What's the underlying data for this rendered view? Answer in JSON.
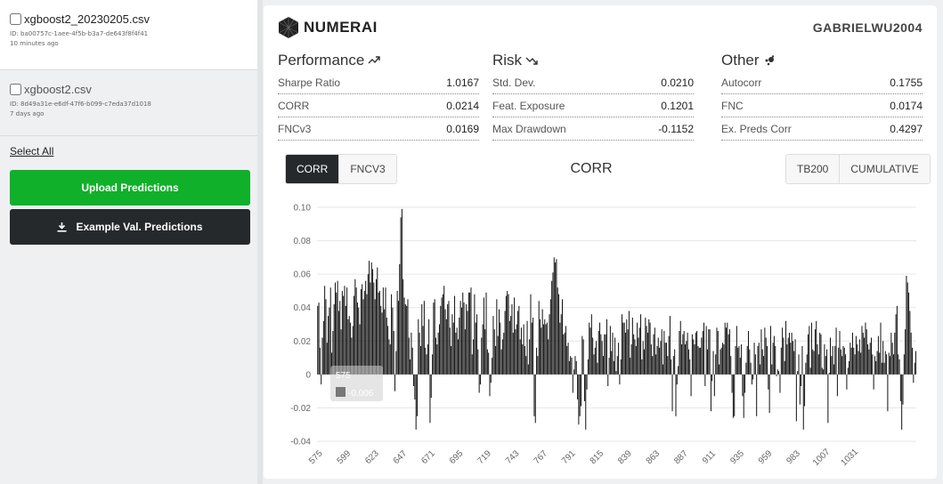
{
  "sidebar": {
    "files": [
      {
        "name": "xgboost2_20230205.csv",
        "id": "ID: ba00757c-1aee-4f5b-b3a7-de643f8f4f41",
        "age": "10 minutes ago"
      },
      {
        "name": "xgboost2.csv",
        "id": "ID: 8d49a31e-e6df-47f6-b099-c7eda37d1018",
        "age": "7 days ago"
      }
    ],
    "select_all": "Select All",
    "upload_label": "Upload Predictions",
    "example_label": "Example Val. Predictions"
  },
  "header": {
    "logo": "NUMERAI",
    "username": "GABRIELWU2004"
  },
  "metrics": {
    "performance": {
      "title": "Performance",
      "rows": [
        {
          "label": "Sharpe Ratio",
          "value": "1.0167"
        },
        {
          "label": "CORR",
          "value": "0.0214"
        },
        {
          "label": "FNCv3",
          "value": "0.0169"
        }
      ]
    },
    "risk": {
      "title": "Risk",
      "rows": [
        {
          "label": "Std. Dev.",
          "value": "0.0210"
        },
        {
          "label": "Feat. Exposure",
          "value": "0.1201"
        },
        {
          "label": "Max Drawdown",
          "value": "-0.1152"
        }
      ]
    },
    "other": {
      "title": "Other",
      "rows": [
        {
          "label": "Autocorr",
          "value": "0.1755"
        },
        {
          "label": "FNC",
          "value": "0.0174"
        },
        {
          "label": "Ex. Preds Corr",
          "value": "0.4297"
        }
      ]
    }
  },
  "chart_controls": {
    "tab_corr": "CORR",
    "tab_fncv3": "FNCV3",
    "title": "CORR",
    "tab_tb200": "TB200",
    "tab_cumulative": "CUMULATIVE"
  },
  "tooltip": {
    "era": "575",
    "value": "-0.006"
  },
  "colors": {
    "green": "#10b02a",
    "dark": "#26292c",
    "bar": "#111111"
  },
  "chart_data": {
    "type": "bar",
    "title": "CORR",
    "xlabel": "",
    "ylabel": "",
    "ylim": [
      -0.04,
      0.1
    ],
    "yticks": [
      0.1,
      0.08,
      0.06,
      0.04,
      0.02,
      0,
      -0.02,
      -0.04
    ],
    "ytick_labels": [
      "0.10",
      "0.08",
      "0.06",
      "0.04",
      "0.02",
      "0",
      "-0.02",
      "-0.04"
    ],
    "xticks": [
      575,
      599,
      623,
      647,
      671,
      695,
      719,
      743,
      767,
      791,
      815,
      839,
      863,
      887,
      911,
      935,
      959,
      983,
      1007,
      1031
    ],
    "x_start": 575,
    "values": [
      0.041,
      0.043,
      0.016,
      -0.006,
      0.022,
      0.032,
      0.053,
      0.045,
      0.019,
      0.035,
      0.04,
      0.052,
      0.013,
      0.026,
      0.042,
      0.055,
      0.049,
      0.056,
      0.038,
      0.044,
      0.027,
      0.05,
      0.047,
      0.053,
      0.041,
      0.052,
      0.033,
      0.035,
      0.031,
      0.022,
      0.029,
      0.047,
      0.057,
      0.052,
      0.043,
      0.04,
      0.03,
      0.051,
      0.054,
      0.045,
      0.05,
      0.056,
      0.048,
      0.06,
      0.068,
      0.055,
      0.067,
      0.063,
      0.055,
      0.045,
      0.057,
      0.064,
      0.049,
      0.05,
      0.041,
      0.037,
      0.052,
      0.039,
      0.052,
      0.034,
      0.029,
      0.021,
      0.018,
      0.048,
      0.04,
      0.026,
      -0.01,
      0.014,
      0.05,
      0.044,
      0.066,
      0.094,
      0.099,
      0.057,
      0.046,
      0.042,
      0.041,
      0.045,
      0.022,
      0.009,
      0.025,
      0.016,
      -0.007,
      -0.015,
      -0.033,
      -0.025,
      0.033,
      0.025,
      0.017,
      0.042,
      0.029,
      0.044,
      0.016,
      0.012,
      0.018,
      0.033,
      -0.029,
      -0.014,
      0.012,
      0.043,
      0.045,
      0.022,
      0.018,
      0.025,
      0.03,
      0.041,
      0.046,
      0.048,
      0.053,
      0.039,
      0.033,
      0.042,
      0.044,
      0.028,
      0.017,
      0.036,
      0.031,
      0.047,
      0.025,
      0.028,
      0.021,
      0.034,
      0.044,
      0.04,
      0.049,
      0.043,
      0.027,
      0.042,
      0.038,
      0.049,
      0.049,
      0.052,
      0.012,
      0.021,
      0.048,
      0.031,
      0.036,
      0.015,
      -0.011,
      -0.006,
      0.022,
      0.03,
      0.046,
      0.027,
      0.049,
      0.015,
      0.013,
      -0.013,
      -0.005,
      0.01,
      0.035,
      0.027,
      0.017,
      0.045,
      0.023,
      0.039,
      0.031,
      0.015,
      0.021,
      0.025,
      0.038,
      0.047,
      0.05,
      0.048,
      0.032,
      0.035,
      0.042,
      0.025,
      0.046,
      0.027,
      0.03,
      0.038,
      0.041,
      0.021,
      0.028,
      0.018,
      0.03,
      0.017,
      0.011,
      0.032,
      0.006,
      0.021,
      0.048,
      0.031,
      0.034,
      -0.025,
      -0.029,
      0.016,
      0.011,
      0.044,
      0.033,
      0.028,
      0.039,
      0.03,
      0.033,
      0.03,
      0.031,
      0.021,
      0.036,
      0.045,
      0.056,
      0.061,
      0.07,
      0.067,
      0.069,
      0.052,
      0.048,
      0.031,
      0.036,
      0.045,
      0.024,
      0.025,
      0.029,
      0.017,
      0.019,
      0.008,
      0.011,
      0.01,
      -0.011,
      0.003,
      0.011,
      0.008,
      -0.015,
      -0.03,
      -0.025,
      -0.019,
      0.023,
      0.021,
      -0.016,
      -0.033,
      -0.009,
      0.009,
      0.031,
      0.028,
      0.036,
      0.022,
      0.012,
      0.016,
      0.02,
      0.007,
      0.026,
      0.031,
      0.024,
      0.02,
      0.011,
      0.024,
      0.024,
      0.033,
      -0.007,
      0.01,
      0.029,
      0.014,
      0.025,
      0.008,
      0.022,
      0.002,
      0.011,
      0.019,
      -0.006,
      0.009,
      0.036,
      0.031,
      0.031,
      0.025,
      0.033,
      0.027,
      0.038,
      0.01,
      0.018,
      0.034,
      0.024,
      0.021,
      0.017,
      0.031,
      0.022,
      0.028,
      0.036,
      0.009,
      0.02,
      0.015,
      0.034,
      0.029,
      0.025,
      0.033,
      0.031,
      0.018,
      0.011,
      0.024,
      0.028,
      0.012,
      0.017,
      0.022,
      0.016,
      0.02,
      0.027,
      0.006,
      0.026,
      0.019,
      0.019,
      0.011,
      0.023,
      0.035,
      0.009,
      -0.022,
      0.011,
      0.015,
      -0.025,
      -0.006,
      0.005,
      0.026,
      0.032,
      0.018,
      0.024,
      0.026,
      0.018,
      0.02,
      0.025,
      0.015,
      0.009,
      -0.013,
      0.024,
      0.021,
      0.018,
      0.025,
      0.026,
      0.017,
      0.016,
      0.016,
      0.022,
      0.026,
      0.031,
      -0.007,
      0.029,
      0.015,
      0.027,
      0.027,
      -0.022,
      -0.004,
      0.014,
      -0.013,
      0.012,
      0.028,
      0.026,
      0.006,
      0.015,
      0.016,
      0.019,
      0.018,
      0.031,
      0.028,
      0.031,
      0.024,
      0.027,
      0.011,
      -0.011,
      -0.026,
      -0.025,
      0.017,
      0.029,
      0.016,
      0.017,
      0.01,
      0.018,
      -0.013,
      -0.026,
      -0.011,
      0.007,
      0.017,
      0.026,
      0.015,
      0.007,
      -0.006,
      -0.003,
      0.019,
      0.012,
      -0.025,
      0.017,
      0.019,
      0.006,
      0.027,
      0.015,
      0.011,
      0.028,
      0.022,
      0.017,
      -0.009,
      -0.023,
      0.029,
      0.006,
      0.019,
      0.023,
      0.017,
      -0.001,
      0.003,
      0.002,
      -0.011,
      0.016,
      0.028,
      0.022,
      0.008,
      0.032,
      0.018,
      0.022,
      0.025,
      0.019,
      0.025,
      0.02,
      0.014,
      0.021,
      -0.028,
      0.002,
      0.012,
      -0.018,
      -0.007,
      0.017,
      -0.033,
      -0.019,
      0.007,
      0.012,
      0.024,
      0.029,
      0.004,
      0.031,
      0.015,
      0.014,
      0.027,
      0.032,
      0.018,
      0.012,
      0.025,
      0.024,
      0.004,
      0.003,
      0.018,
      0.011,
      0.015,
      -0.029,
      0.001,
      0.022,
      0.011,
      0.017,
      0.006,
      0.017,
      0.028,
      -0.013,
      0.016,
      0.026,
      0.015,
      0.011,
      0.017,
      0.016,
      0.012,
      -0.009,
      0.004,
      0.008,
      0.019,
      0.016,
      0.025,
      0.016,
      0.012,
      0.023,
      0.018,
      0.014,
      0.021,
      0.013,
      0.029,
      0.025,
      0.022,
      0.031,
      0.027,
      0.018,
      0.015,
      0.019,
      0.022,
      0.012,
      -0.009,
      0.011,
      0.008,
      0.014,
      0.023,
      0.013,
      0.031,
      0.007,
      0.02,
      0.007,
      0.014,
      0.012,
      -0.022,
      0.013,
      0.011,
      0.025,
      0.019,
      0.012,
      0.025,
      0.036,
      0.041,
      0.012,
      0.009,
      -0.016,
      -0.033,
      -0.018,
      0.012,
      0.027,
      0.059,
      0.055,
      0.049,
      0.038,
      0.025,
      0.016,
      -0.005,
      0.007,
      0.014
    ]
  }
}
